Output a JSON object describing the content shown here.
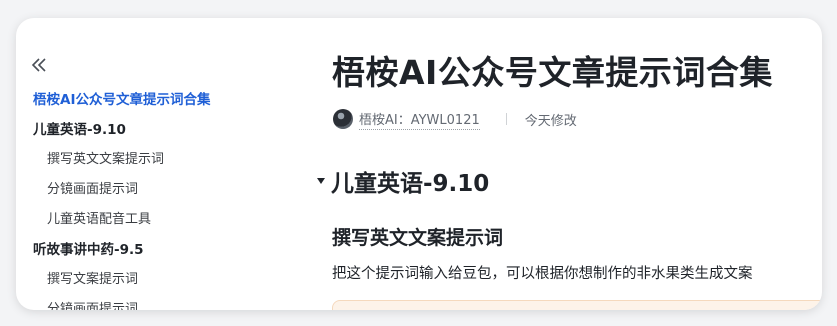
{
  "sidebar": {
    "collapse_icon": "double-chevron-left-icon",
    "toc": [
      {
        "label": "梧桉AI公众号文章提示词合集",
        "level": 1,
        "active": true
      },
      {
        "label": "儿童英语-9.10",
        "level": 1,
        "active": false
      },
      {
        "label": "撰写英文文案提示词",
        "level": 2,
        "active": false
      },
      {
        "label": "分镜画面提示词",
        "level": 2,
        "active": false
      },
      {
        "label": "儿童英语配音工具",
        "level": 2,
        "active": false
      },
      {
        "label": "听故事讲中药-9.5",
        "level": 1,
        "active": false
      },
      {
        "label": "撰写文案提示词",
        "level": 2,
        "active": false
      },
      {
        "label": "分镜画面提示词",
        "level": 2,
        "active": false
      }
    ]
  },
  "document": {
    "title": "梧桉AI公众号文章提示词合集",
    "author": "梧桉AI：AYWL0121",
    "modified": "今天修改",
    "heading1": "儿童英语-9.10",
    "heading2": "撰写英文文案提示词",
    "paragraph": "把这个提示词输入给豆包，可以根据你想制作的非水果类生成文案"
  },
  "colors": {
    "accent": "#1f5fd6",
    "text": "#1f2329",
    "muted": "#646a73",
    "callout_bg": "#fdf3e9"
  }
}
